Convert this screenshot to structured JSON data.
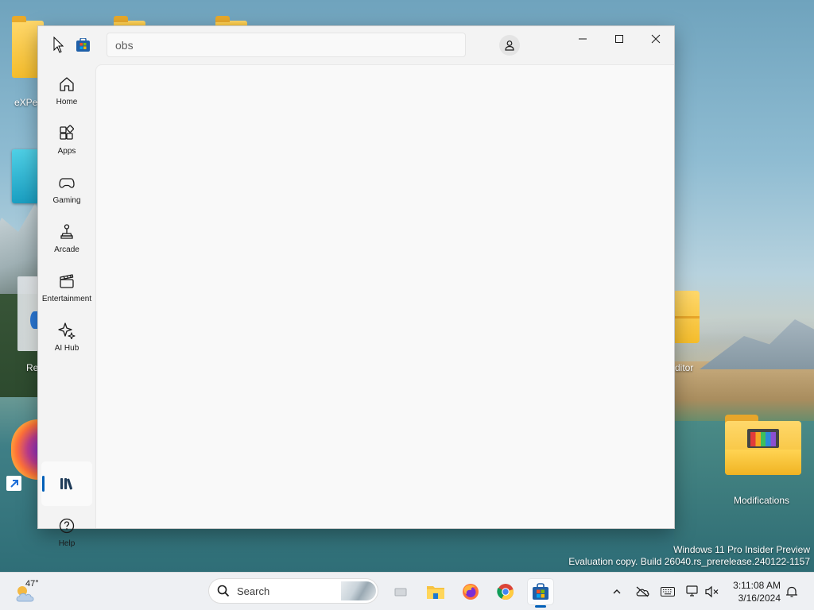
{
  "desktop": {
    "icons": [
      {
        "label": "eXPer"
      },
      {
        "label": "Re"
      },
      {
        "label": "ditor"
      },
      {
        "label": "Modifications"
      }
    ],
    "watermark_line1": "Windows 11 Pro Insider Preview",
    "watermark_line2": "Evaluation copy. Build 26040.rs_prerelease.240122-1157"
  },
  "store": {
    "search_value": "obs",
    "nav": [
      {
        "label": "Home",
        "icon": "home-icon"
      },
      {
        "label": "Apps",
        "icon": "apps-icon"
      },
      {
        "label": "Gaming",
        "icon": "gamepad-icon"
      },
      {
        "label": "Arcade",
        "icon": "joystick-icon"
      },
      {
        "label": "Entertainment",
        "icon": "clapperboard-icon"
      },
      {
        "label": "AI Hub",
        "icon": "sparkle-icon"
      }
    ],
    "library_icon": "library-icon",
    "help_label": "Help"
  },
  "taskbar": {
    "weather_temp": "47°",
    "search_placeholder": "Search",
    "clock_time": "3:11:08 AM",
    "clock_date": "3/16/2024"
  },
  "colors": {
    "accent": "#005fb8",
    "window_bg": "#f3f3f3",
    "content_bg": "#f9f9f9",
    "taskbar_bg": "#eef0f3"
  }
}
